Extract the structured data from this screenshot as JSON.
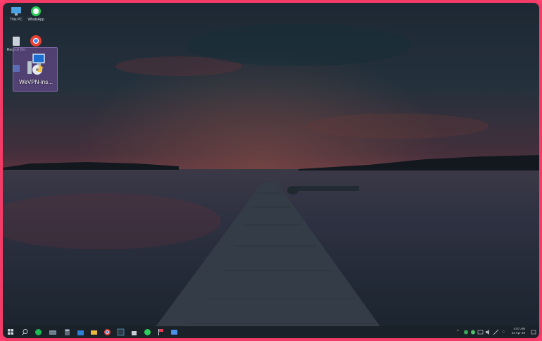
{
  "desktop": {
    "icons": [
      {
        "name": "this-pc-icon",
        "label": "This PC"
      },
      {
        "name": "whatsapp-icon",
        "label": "WhatsApp"
      },
      {
        "name": "recycle-bin-icon",
        "label": "Recycle Bin"
      },
      {
        "name": "chrome-icon",
        "label": ""
      },
      {
        "name": "partial-icon",
        "label": ""
      }
    ],
    "selected_icon": {
      "name": "wevpn-installer-icon",
      "label": "WeVPN-ins..."
    }
  },
  "taskbar": {
    "apps": [
      "windows-start-icon",
      "search-icon",
      "spotify-icon",
      "network-drive-icon",
      "calculator-icon",
      "store-icon",
      "file-explorer-icon",
      "chrome-icon",
      "terminal-icon",
      "shopping-bag-icon",
      "whatsapp-icon",
      "flag-icon",
      "vpn-icon"
    ],
    "clock_time": "4:07 AM",
    "clock_date": "24 Apr 20",
    "colors": {
      "bar": "#1b2129",
      "frame": "#f23b67"
    }
  }
}
